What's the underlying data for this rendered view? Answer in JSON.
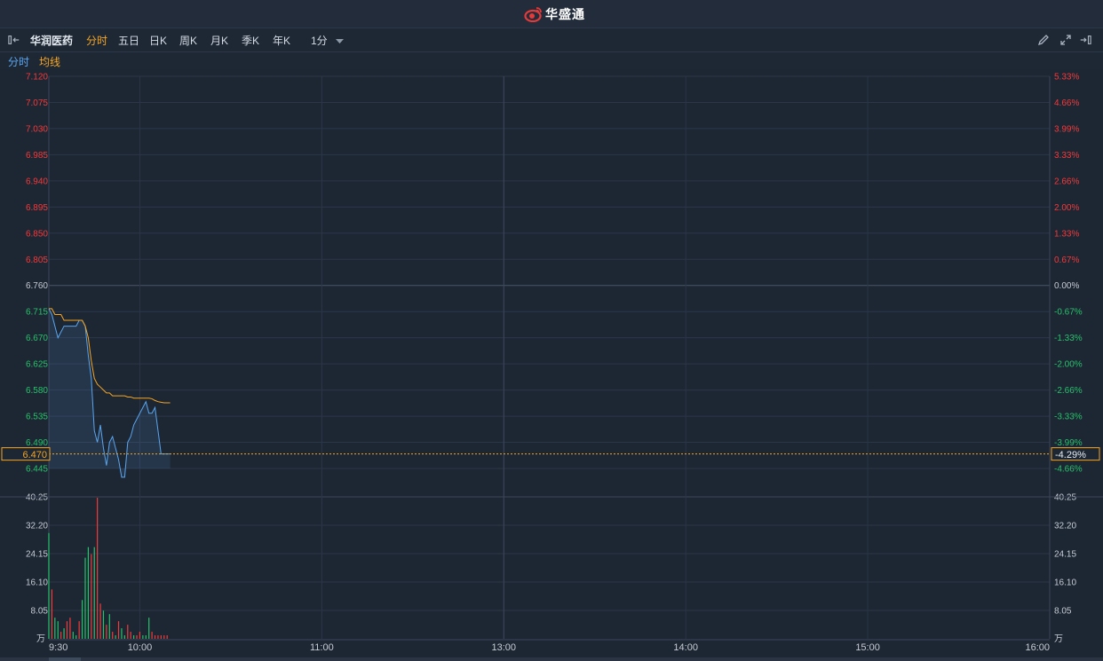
{
  "header": {
    "brand": "华盛通"
  },
  "toolbar": {
    "stock_name": "华润医药",
    "tabs": [
      {
        "label": "分时",
        "active": true
      },
      {
        "label": "五日",
        "active": false
      },
      {
        "label": "日K",
        "active": false
      },
      {
        "label": "周K",
        "active": false
      },
      {
        "label": "月K",
        "active": false
      },
      {
        "label": "季K",
        "active": false
      },
      {
        "label": "年K",
        "active": false
      }
    ],
    "interval": {
      "label": "1分",
      "icon": "caret-down-icon"
    },
    "right_icons": [
      "pencil-icon",
      "expand-icon",
      "collapse-right-icon"
    ],
    "left_icon": "collapse-left-icon"
  },
  "legend": {
    "price_label": "分时",
    "avg_label": "均线"
  },
  "colors": {
    "up": "#f23b3b",
    "down": "#27c26b",
    "neutral": "#c6ccd5",
    "price_line": "#5aa6ef",
    "avg_line": "#f6a623",
    "highlight": "#f6a623",
    "grid": "#2b3647",
    "background": "#1d2633"
  },
  "chart_data": {
    "type": "line",
    "price_ticks": [
      "7.120",
      "7.075",
      "7.030",
      "6.985",
      "6.940",
      "6.895",
      "6.850",
      "6.805",
      "6.760",
      "6.715",
      "6.670",
      "6.625",
      "6.580",
      "6.535",
      "6.490",
      "6.445"
    ],
    "pct_ticks": [
      "5.33%",
      "4.66%",
      "3.99%",
      "3.33%",
      "2.66%",
      "2.00%",
      "1.33%",
      "0.67%",
      "0.00%",
      "-0.67%",
      "-1.33%",
      "-2.00%",
      "-2.66%",
      "-3.33%",
      "-3.99%",
      "-4.66%"
    ],
    "prev_close": 6.76,
    "ylim": [
      6.445,
      7.12
    ],
    "current_price": "6.470",
    "current_pct": "-4.29%",
    "x_labels": [
      "9:30",
      "10:00",
      "11:00",
      "13:00",
      "14:00",
      "15:00",
      "16:00"
    ],
    "series": [
      {
        "name": "分时",
        "values": [
          6.72,
          6.71,
          6.69,
          6.67,
          6.68,
          6.69,
          6.69,
          6.69,
          6.69,
          6.69,
          6.7,
          6.7,
          6.69,
          6.64,
          6.6,
          6.51,
          6.49,
          6.52,
          6.48,
          6.45,
          6.49,
          6.5,
          6.48,
          6.46,
          6.43,
          6.43,
          6.49,
          6.5,
          6.52,
          6.53,
          6.54,
          6.55,
          6.56,
          6.54,
          6.54,
          6.55,
          6.51,
          6.47,
          6.47,
          6.47,
          6.47
        ]
      },
      {
        "name": "均线",
        "values": [
          6.72,
          6.72,
          6.71,
          6.71,
          6.71,
          6.7,
          6.7,
          6.7,
          6.7,
          6.7,
          6.7,
          6.7,
          6.69,
          6.67,
          6.63,
          6.6,
          6.59,
          6.585,
          6.58,
          6.575,
          6.575,
          6.57,
          6.57,
          6.57,
          6.57,
          6.57,
          6.568,
          6.568,
          6.566,
          6.566,
          6.566,
          6.566,
          6.566,
          6.566,
          6.565,
          6.562,
          6.56,
          6.559,
          6.558,
          6.558,
          6.558
        ]
      }
    ],
    "volume": {
      "ticks": [
        "40.25",
        "32.20",
        "24.15",
        "16.10",
        "8.05"
      ],
      "unit": "万",
      "ylim": [
        0,
        40.25
      ],
      "values": [
        30,
        14,
        6,
        5,
        2,
        3,
        5,
        6,
        2,
        1,
        5,
        11,
        23,
        26,
        24,
        26,
        40,
        10,
        8,
        4,
        7,
        2,
        1,
        5,
        3,
        1,
        4,
        2,
        1,
        1,
        2,
        1,
        1,
        6,
        2,
        1,
        1,
        1,
        1,
        1,
        0
      ],
      "colors": [
        "g",
        "r",
        "g",
        "g",
        "r",
        "g",
        "r",
        "r",
        "g",
        "g",
        "r",
        "g",
        "g",
        "g",
        "r",
        "g",
        "r",
        "r",
        "g",
        "r",
        "g",
        "r",
        "g",
        "r",
        "g",
        "g",
        "r",
        "r",
        "g",
        "r",
        "r",
        "g",
        "g",
        "g",
        "r",
        "r",
        "r",
        "r",
        "r",
        "r",
        "r"
      ]
    }
  }
}
